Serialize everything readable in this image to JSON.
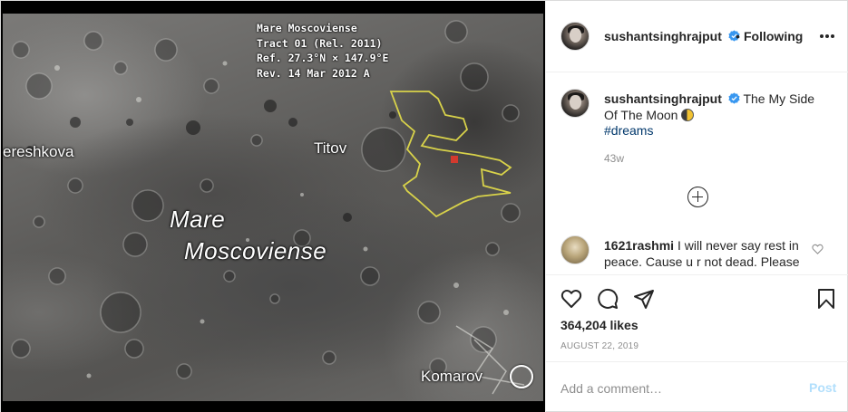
{
  "photo": {
    "overlay_lines": [
      "Mare Moscoviense",
      "Tract 01 (Rel. 2011)",
      "Ref. 27.3°N × 147.9°E",
      "Rev. 14 Mar 2012 A"
    ],
    "labels": {
      "reshkova": "ereshkova",
      "titov": "Titov",
      "mare_line1": "Mare",
      "mare_line2": "Moscoviense",
      "komarov": "Komarov"
    },
    "colors": {
      "tract_outline": "#d8d24a",
      "tract_marker": "#d23a2e"
    }
  },
  "header": {
    "username": "sushantsinghrajput",
    "separator": "•",
    "follow_label": "Following",
    "more_icon": "more-horizontal-icon"
  },
  "caption": {
    "username": "sushantsinghrajput",
    "text": "The My Side Of The Moon",
    "emoji": "moon-icon",
    "hashtag": "#dreams",
    "time_ago": "43w"
  },
  "load_more_icon": "plus-circle-icon",
  "comments": [
    {
      "username": "1621rashmi",
      "text": "I will never say rest in peace. Cause u r not dead. Please"
    }
  ],
  "actions": {
    "icons": [
      "heart-icon",
      "comment-icon",
      "share-icon",
      "bookmark-icon"
    ],
    "likes": "364,204 likes",
    "date": "AUGUST 22, 2019"
  },
  "composer": {
    "placeholder": "Add a comment…",
    "post_label": "Post"
  },
  "colors": {
    "verified": "#3897f0",
    "link": "#00376b",
    "muted": "#8e8e8e",
    "post_disabled": "#b2dffc"
  }
}
